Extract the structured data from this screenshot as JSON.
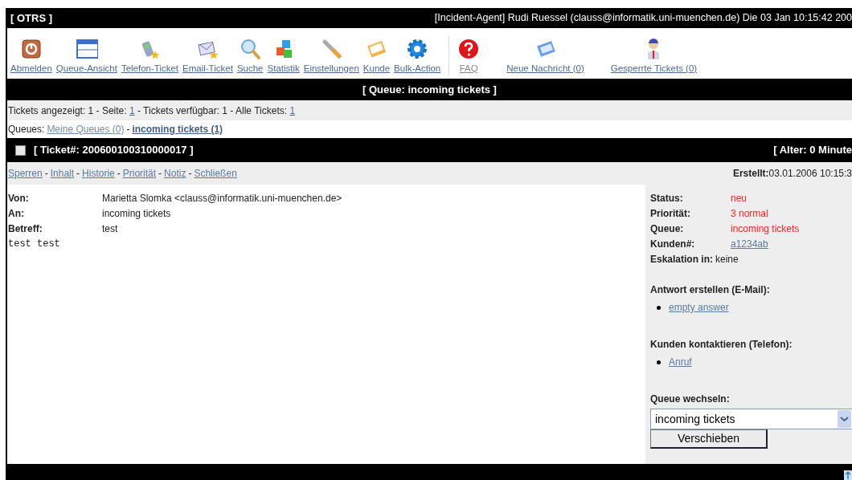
{
  "header": {
    "logo": "[ OTRS ]",
    "user_info": "[Incident-Agent] Rudi Ruessel (clauss@informatik.uni-muenchen.de) Die 03 Jan 10:15:42 200"
  },
  "toolbar": {
    "items": [
      {
        "label": "Abmelden",
        "kind": "power",
        "dimmed": false,
        "separator_before": false
      },
      {
        "label": "Queue-Ansicht",
        "kind": "window",
        "dimmed": false,
        "separator_before": false
      },
      {
        "label": "Telefon-Ticket",
        "kind": "phone",
        "dimmed": false,
        "separator_before": false
      },
      {
        "label": "Email-Ticket",
        "kind": "mail",
        "dimmed": false,
        "separator_before": false
      },
      {
        "label": "Suche",
        "kind": "search",
        "dimmed": false,
        "separator_before": false
      },
      {
        "label": "Statistik",
        "kind": "cubes",
        "dimmed": false,
        "separator_before": false
      },
      {
        "label": "Einstellungen",
        "kind": "wrench",
        "dimmed": false,
        "separator_before": false
      },
      {
        "label": "Kunde",
        "kind": "folder",
        "dimmed": false,
        "separator_before": false
      },
      {
        "label": "Bulk-Action",
        "kind": "gear",
        "dimmed": false,
        "separator_before": false
      },
      {
        "label": "FAQ",
        "kind": "help",
        "dimmed": true,
        "separator_before": true
      },
      {
        "label": "Neue Nachricht (0)",
        "kind": "message",
        "dimmed": false,
        "separator_before": false
      },
      {
        "label": "Gesperrte Tickets (0)",
        "kind": "person",
        "dimmed": false,
        "separator_before": false
      }
    ]
  },
  "queue_title": "[ Queue: incoming tickets ]",
  "info_line": [
    {
      "text": "Tickets angezeigt: 1 - Seite: ",
      "link": false
    },
    {
      "text": "1",
      "link": true
    },
    {
      "text": " - Tickets verfügbar: 1 - Alle Tickets: ",
      "link": false
    },
    {
      "text": "1",
      "link": true
    }
  ],
  "queues": {
    "label": "Queues:",
    "separator": "-",
    "items": [
      {
        "label": "Meine Queues (0)",
        "selected": false
      },
      {
        "label": "incoming tickets (1)",
        "selected": true
      }
    ]
  },
  "ticket": {
    "title": "[ Ticket#: 200600100310000017 ]",
    "checked": false,
    "age": "[ Alter: 0 Minute",
    "action_separator": "-",
    "actions": [
      "Sperren",
      "Inhalt",
      "Historie",
      "Priorität",
      "Notiz",
      "Schließen"
    ],
    "created_label": "Erstellt:",
    "created": "03.01.2006 10:15:3",
    "headers": [
      {
        "label": "Von:",
        "value": "Marietta Slomka <clauss@informatik.uni-muenchen.de>"
      },
      {
        "label": "An:",
        "value": "incoming tickets"
      },
      {
        "label": "Betreff:",
        "value": "test"
      }
    ],
    "body": "test test",
    "properties": [
      {
        "label": "Status:",
        "value": "neu",
        "kind": "highlight"
      },
      {
        "label": "Priorität:",
        "value": "3 normal",
        "kind": "highlight"
      },
      {
        "label": "Queue:",
        "value": "incoming tickets",
        "kind": "highlight"
      },
      {
        "label": "Kunden#:",
        "value": "a1234ab",
        "kind": "link"
      },
      {
        "label": "Eskalation in:",
        "value": "keine",
        "kind": "plain"
      }
    ],
    "answer": {
      "title": "Antwort erstellen (E-Mail):",
      "items": [
        "empty answer"
      ]
    },
    "contact": {
      "title": "Kunden kontaktieren (Telefon):",
      "items": [
        "Anruf"
      ]
    },
    "move": {
      "title": "Queue wechseln:",
      "value": "incoming tickets",
      "button": "Verschieben"
    }
  }
}
